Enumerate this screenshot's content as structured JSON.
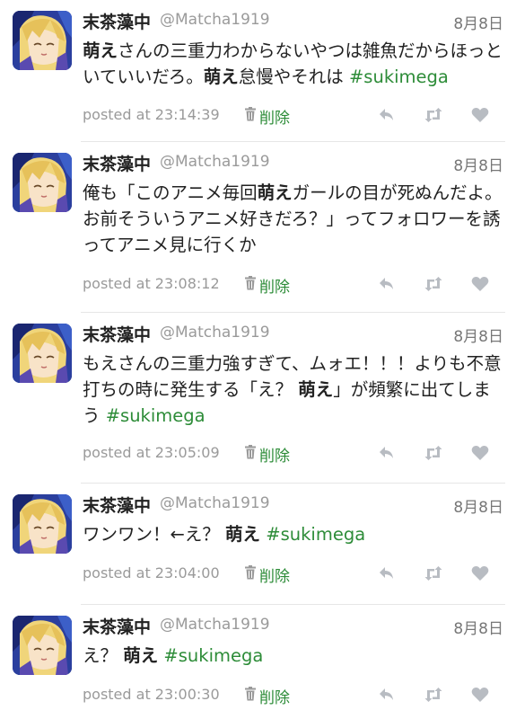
{
  "tweets": [
    {
      "name": "末茶藻中",
      "handle": "@Matcha1919",
      "date": "8月8日",
      "segments": [
        {
          "t": "萌え",
          "b": true
        },
        {
          "t": "さんの三重力わからないやつは雑魚だからほっといていいだろ。"
        },
        {
          "t": "萌え",
          "b": true
        },
        {
          "t": "怠慢やそれは "
        },
        {
          "t": "#sukimega",
          "h": true
        }
      ],
      "posted": "posted at 23:14:39",
      "delete_label": "削除"
    },
    {
      "name": "末茶藻中",
      "handle": "@Matcha1919",
      "date": "8月8日",
      "segments": [
        {
          "t": "俺も「このアニメ毎回"
        },
        {
          "t": "萌え",
          "b": true
        },
        {
          "t": "ガールの目が死ぬんだよ。お前そういうアニメ好きだろ？」ってフォロワーを誘ってアニメ見に行くか"
        }
      ],
      "posted": "posted at 23:08:12",
      "delete_label": "削除"
    },
    {
      "name": "末茶藻中",
      "handle": "@Matcha1919",
      "date": "8月8日",
      "segments": [
        {
          "t": "もえさんの三重力強すぎて、ムォエ！！！よりも不意打ちの時に発生する「え？ "
        },
        {
          "t": "萌え",
          "b": true
        },
        {
          "t": "」が頻繁に出てしまう "
        },
        {
          "t": "#sukimega",
          "h": true
        }
      ],
      "posted": "posted at 23:05:09",
      "delete_label": "削除"
    },
    {
      "name": "末茶藻中",
      "handle": "@Matcha1919",
      "date": "8月8日",
      "segments": [
        {
          "t": "ワンワン！←え？ "
        },
        {
          "t": "萌え",
          "b": true
        },
        {
          "t": " "
        },
        {
          "t": "#sukimega",
          "h": true
        }
      ],
      "posted": "posted at 23:04:00",
      "delete_label": "削除"
    },
    {
      "name": "末茶藻中",
      "handle": "@Matcha1919",
      "date": "8月8日",
      "segments": [
        {
          "t": "え？ "
        },
        {
          "t": "萌え",
          "b": true
        },
        {
          "t": " "
        },
        {
          "t": "#sukimega",
          "h": true
        }
      ],
      "posted": "posted at 23:00:30",
      "delete_label": "削除"
    }
  ],
  "icons": {
    "delete": "trash-icon",
    "reply": "reply-icon",
    "retweet": "retweet-icon",
    "favorite": "heart-icon"
  },
  "colors": {
    "hashtag": "#2d8c38",
    "delete_label": "#2d8c38",
    "meta_text": "#9a9a9a",
    "action_icon": "#b8bcc2"
  }
}
